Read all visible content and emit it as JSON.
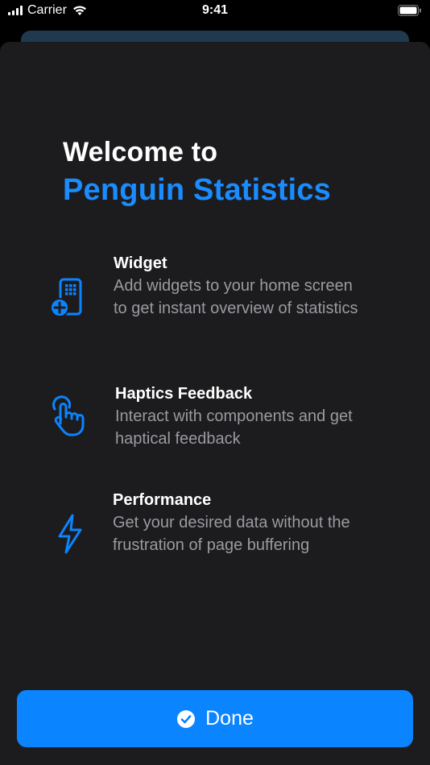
{
  "status_bar": {
    "carrier": "Carrier",
    "time": "9:41"
  },
  "welcome": {
    "line1": "Welcome to",
    "line2": "Penguin Statistics"
  },
  "features": [
    {
      "icon": "widget-add-icon",
      "title": "Widget",
      "description": "Add widgets to your home screen to get instant overview of statistics"
    },
    {
      "icon": "hand-tap-icon",
      "title": "Haptics Feedback",
      "description": "Interact with components and get haptical feedback"
    },
    {
      "icon": "lightning-bolt-icon",
      "title": "Performance",
      "description": "Get your desired data without the frustration of page buffering"
    }
  ],
  "done_button": {
    "label": "Done",
    "icon": "checkmark-circle-icon"
  },
  "colors": {
    "accent": "#0a84ff",
    "title_accent": "#1a8cff",
    "sheet_background": "#1c1c1e",
    "secondary_text": "#9a9aa0"
  }
}
